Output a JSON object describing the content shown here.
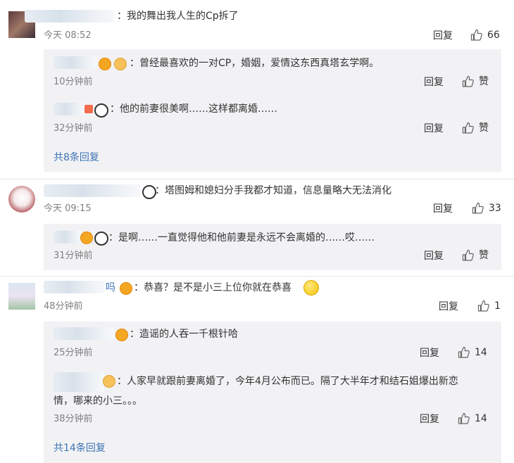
{
  "comments": [
    {
      "text": "：我的舞出我人生的Cp拆了",
      "time": "今天 08:52",
      "reply_label": "回复",
      "likes": "66",
      "replies": [
        {
          "text": "：曾经最喜欢的一对CP，婚姻，爱情这东西真塔玄学啊。",
          "time": "10分钟前",
          "reply_label": "回复",
          "likes": "赞"
        },
        {
          "text": "：他的前妻很美啊……这样都离婚……",
          "time": "32分钟前",
          "reply_label": "回复",
          "likes": "赞"
        }
      ],
      "more": "共8条回复"
    },
    {
      "text": "：塔图姆和媳妇分手我都才知道，信息量略大无法消化",
      "time": "今天 09:15",
      "reply_label": "回复",
      "likes": "33",
      "replies": [
        {
          "text": "：是啊……一直觉得他和他前妻是永远不会离婚的……哎……",
          "time": "31分钟前",
          "reply_label": "回复",
          "likes": "赞"
        }
      ]
    },
    {
      "user_suffix": "吗",
      "text": "：恭喜？是不是小三上位你就在恭喜",
      "time": "48分钟前",
      "reply_label": "回复",
      "likes": "1",
      "replies": [
        {
          "text": "：造谣的人吞一千根针哈",
          "time": "25分钟前",
          "reply_label": "回复",
          "likes": "14"
        },
        {
          "text_line1": "：人家早就跟前妻离婚了，今年4月公布而已。隔了大半年才和结石姐爆出新恋",
          "text_line2": "情，哪来的小三。。。",
          "time": "38分钟前",
          "reply_label": "回复",
          "likes": "14"
        }
      ],
      "more": "共14条回复"
    }
  ],
  "colors": {
    "link": "#3d74b3",
    "text": "#333333",
    "time": "#808080",
    "reply_bg": "#f2f2f5"
  }
}
